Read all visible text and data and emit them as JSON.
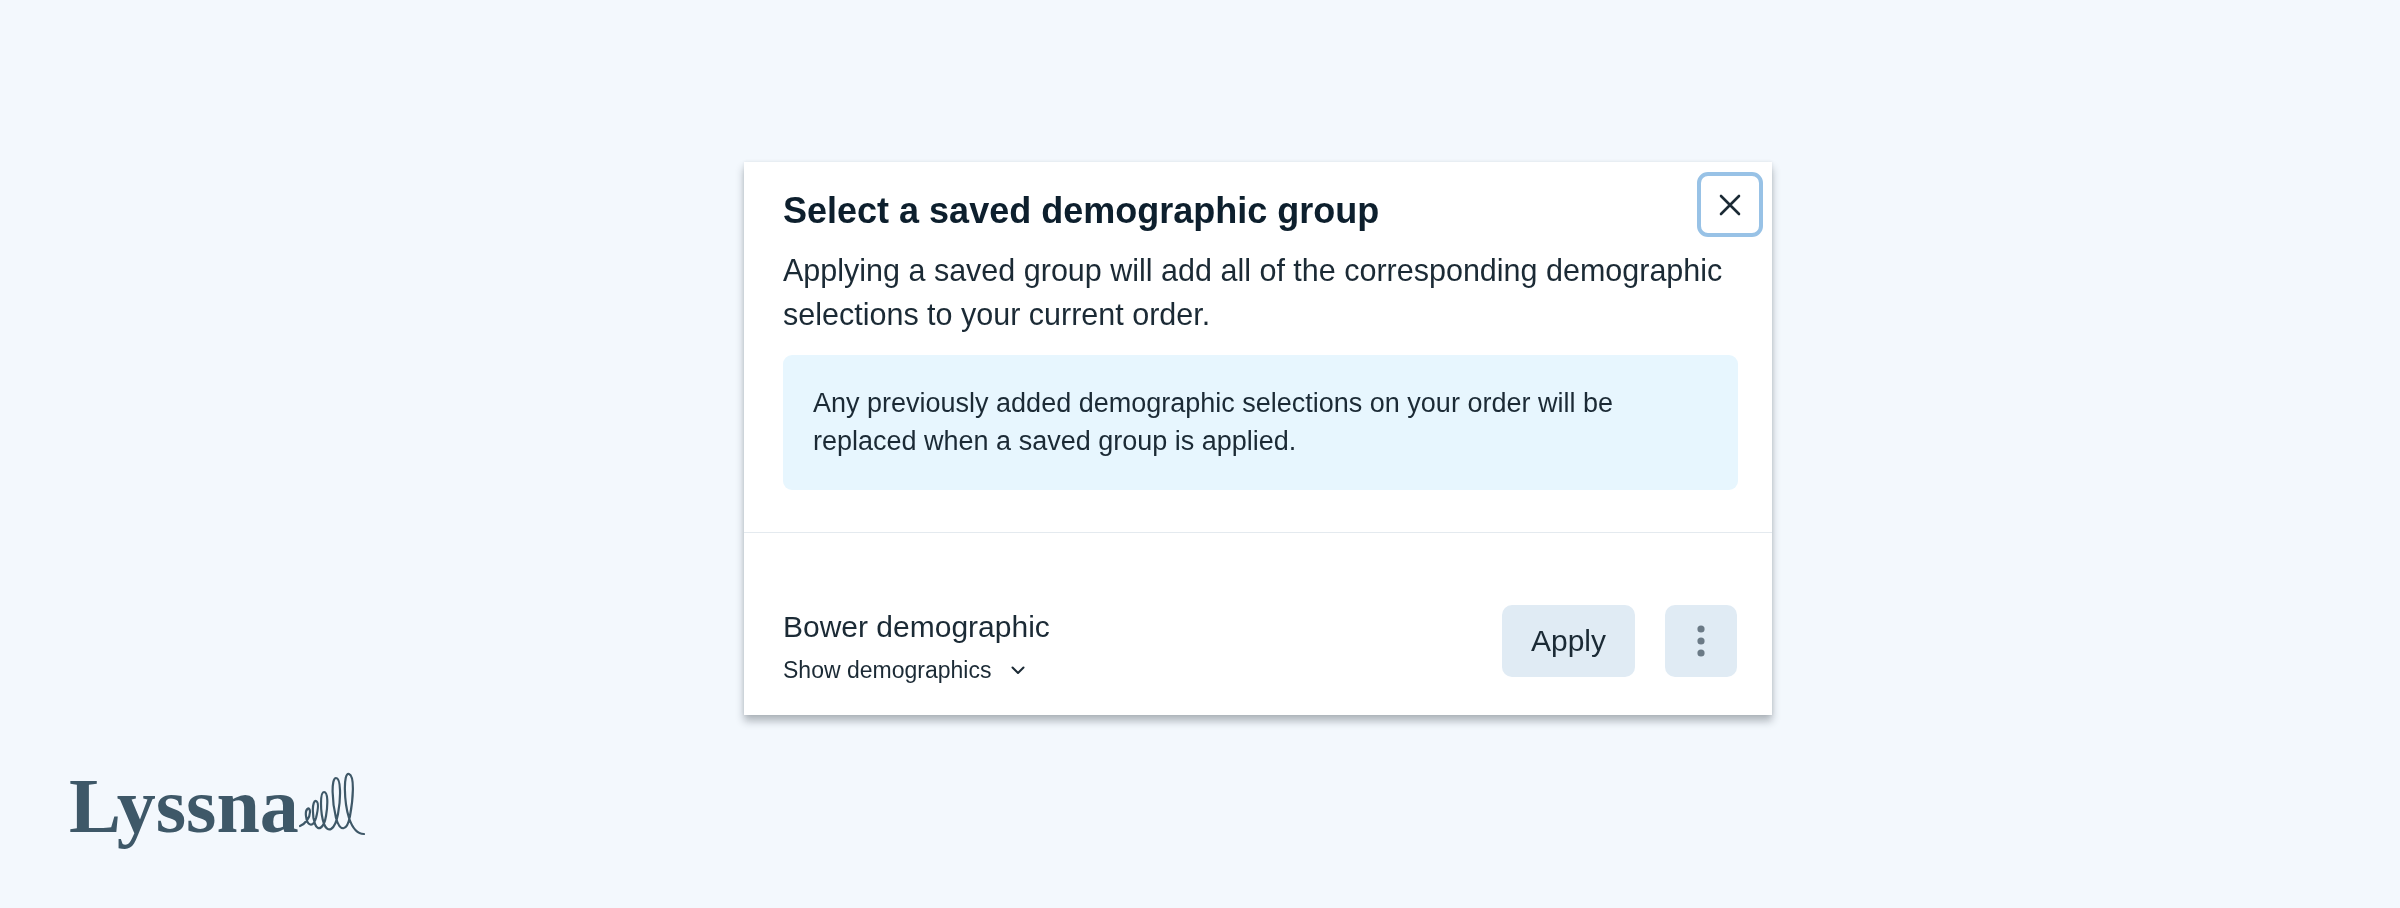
{
  "dialog": {
    "title": "Select a saved demographic group",
    "close_button": {
      "focused": true
    },
    "description": "Applying a saved group will add all of the corresponding demographic selections to your current order.",
    "notice": "Any previously added demographic selections on your order will be replaced when a saved group is applied.",
    "groups": [
      {
        "name": "Bower demographic",
        "toggle": "Show demographics",
        "expanded": false,
        "action": "Apply"
      }
    ]
  },
  "logo": {
    "text": "Lyssna"
  }
}
